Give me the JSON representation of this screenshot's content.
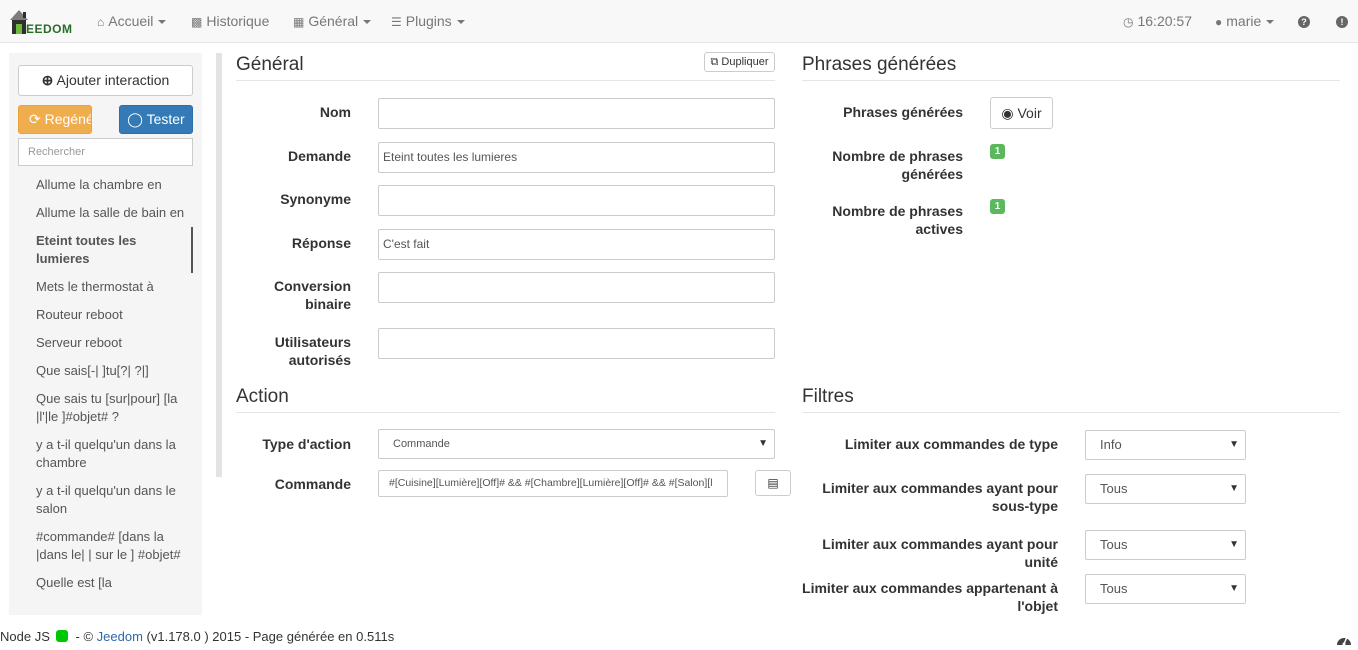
{
  "navbar": {
    "brand": "EEDOM",
    "items": [
      {
        "label": "Accueil",
        "icon": "home-icon"
      },
      {
        "label": "Historique",
        "icon": "bar-chart-icon"
      },
      {
        "label": "Général",
        "icon": "table-icon"
      },
      {
        "label": "Plugins",
        "icon": "tasks-icon"
      }
    ],
    "clock": "16:20:57",
    "user": "marie"
  },
  "sidebar": {
    "add_button": "Ajouter interaction",
    "regenerate_button": "Regénérer",
    "test_button": "Tester",
    "search_placeholder": "Rechercher",
    "items": [
      {
        "label": "Allume la chambre en"
      },
      {
        "label": "Allume la salle de bain en"
      },
      {
        "label": "Eteint toutes les lumieres"
      },
      {
        "label": "Mets le thermostat à"
      },
      {
        "label": "Routeur reboot"
      },
      {
        "label": "Serveur reboot"
      },
      {
        "label": "Que sais[-| ]tu[?| ?|]"
      },
      {
        "label": "Que sais tu [sur|pour] [la |l'|le ]#objet# ?"
      },
      {
        "label": "y a t-il quelqu'un dans la chambre"
      },
      {
        "label": "y a t-il quelqu'un dans le salon"
      },
      {
        "label": "#commande# [dans la |dans le| | sur le ] #objet#"
      },
      {
        "label": "Quelle est [la"
      }
    ],
    "active_index": 2
  },
  "general": {
    "title": "Général",
    "duplicate_button": "Dupliquer",
    "fields": {
      "nom": {
        "label": "Nom",
        "value": ""
      },
      "demande": {
        "label": "Demande",
        "value": "Eteint toutes les lumieres"
      },
      "synonyme": {
        "label": "Synonyme",
        "value": ""
      },
      "reponse": {
        "label": "Réponse",
        "value": "C'est fait"
      },
      "conversion": {
        "label": "Conversion binaire",
        "value": ""
      },
      "utilisateurs": {
        "label": "Utilisateurs autorisés",
        "value": ""
      }
    }
  },
  "phrases": {
    "title": "Phrases générées",
    "phrases_label": "Phrases générées",
    "voir_button": "Voir",
    "count_generated_label": "Nombre de phrases générées",
    "count_generated": "1",
    "count_active_label": "Nombre de phrases actives",
    "count_active": "1"
  },
  "action": {
    "title": "Action",
    "type_label": "Type d'action",
    "type_value": "Commande",
    "command_label": "Commande",
    "command_value": "#[Cuisine][Lumière][Off]# && #[Chambre][Lumière][Off]# && #[Salon][l"
  },
  "filtres": {
    "title": "Filtres",
    "type_label": "Limiter aux commandes de type",
    "type_value": "Info",
    "subtype_label": "Limiter aux commandes ayant pour sous-type",
    "subtype_value": "Tous",
    "unit_label": "Limiter aux commandes ayant pour unité",
    "unit_value": "Tous",
    "object_label": "Limiter aux commandes appartenant à l'objet",
    "object_value": "Tous"
  },
  "footer": {
    "node": "Node JS",
    "copyright": "- ©",
    "jeedom": "Jeedom",
    "version": "(v1.178.0 ) 2015 - Page générée en 0.511s"
  },
  "colors": {
    "accent": "#337ab7",
    "warning": "#f0ad4e",
    "success": "#5cb85c",
    "node_status": "#00c800"
  }
}
